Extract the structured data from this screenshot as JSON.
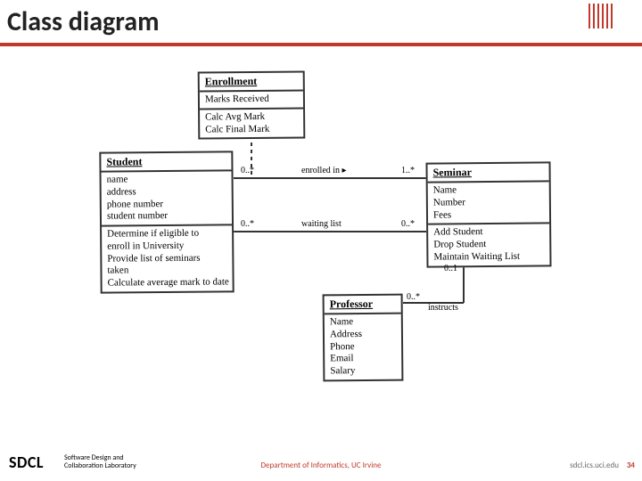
{
  "title": "Class diagram",
  "classes": {
    "enrollment": {
      "name": "Enrollment",
      "attrs": [
        "Marks Received"
      ],
      "ops": [
        "Calc Avg Mark",
        "Calc Final Mark"
      ]
    },
    "student": {
      "name": "Student",
      "attrs": [
        "name",
        "address",
        "phone number",
        "student number"
      ],
      "ops": [
        "Determine if eligible to",
        "enroll in University",
        "Provide list of seminars",
        "taken",
        "Calculate average mark to date"
      ]
    },
    "seminar": {
      "name": "Seminar",
      "attrs": [
        "Name",
        "Number",
        "Fees"
      ],
      "ops": [
        "Add Student",
        "Drop Student",
        "Maintain Waiting List"
      ]
    },
    "professor": {
      "name": "Professor",
      "attrs": [
        "Name",
        "Address",
        "Phone",
        "Email",
        "Salary"
      ]
    }
  },
  "labels": {
    "m_enroll_left": "0..*",
    "m_enroll_right": "1..*",
    "enrolled_in": "enrolled in ▸",
    "m_wait_left": "0..*",
    "m_wait_right": "0..*",
    "waiting_list": "waiting list",
    "m_prof_top": "0..1",
    "m_prof_side": "0..*",
    "instructs": "instructs"
  },
  "footer": {
    "sdcl": "SDCL",
    "sdcl_sub1": "Software Design and",
    "sdcl_sub2": "Collaboration Laboratory",
    "dept": "Department of Informatics, UC Irvine",
    "url": "sdcl.ics.uci.edu",
    "page": "34"
  }
}
